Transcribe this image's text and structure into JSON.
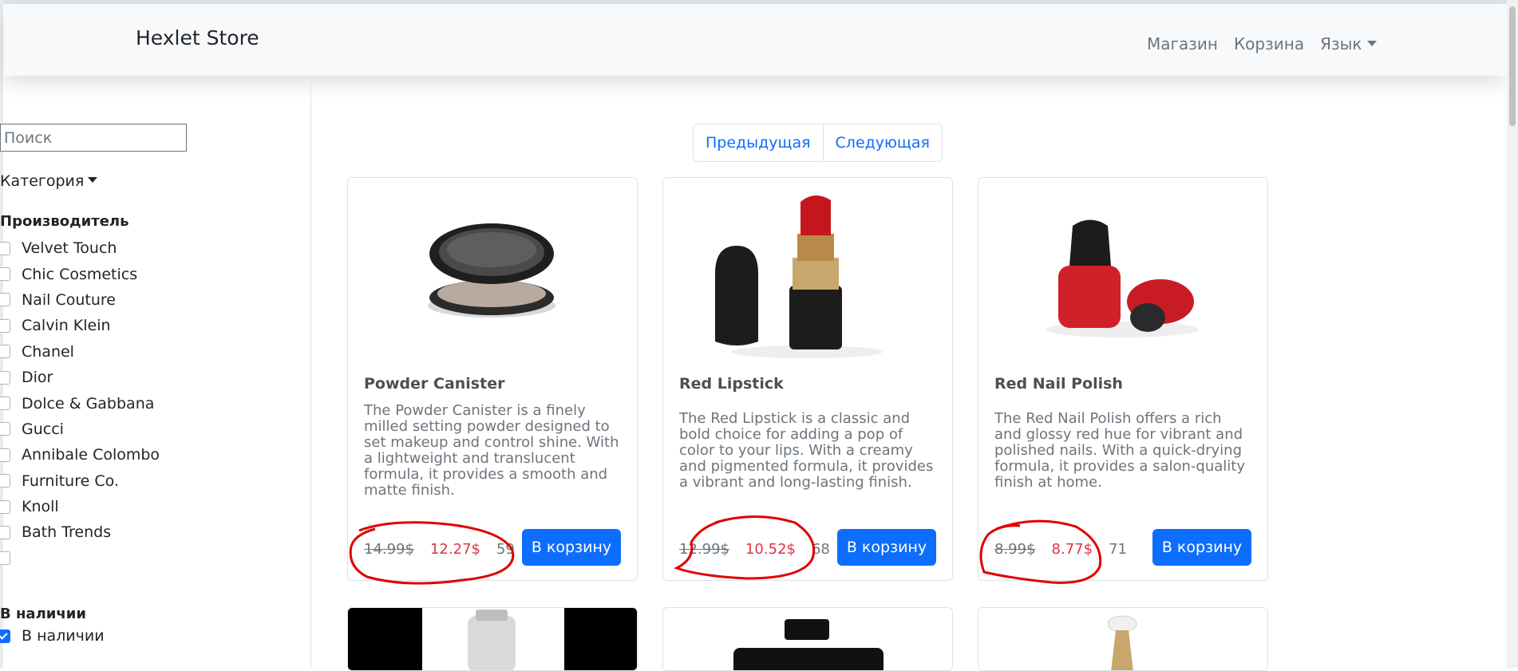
{
  "navbar": {
    "brand": "Hexlet Store",
    "links": [
      "Магазин",
      "Корзина",
      "Язык"
    ]
  },
  "sidebar": {
    "search_placeholder": "Поиск",
    "category_label": "Категория",
    "manufacturer_title": "Производитель",
    "manufacturers": [
      "Velvet Touch",
      "Chic Cosmetics",
      "Nail Couture",
      "Calvin Klein",
      "Chanel",
      "Dior",
      "Dolce & Gabbana",
      "Gucci",
      "Annibale Colombo",
      "Furniture Co.",
      "Knoll",
      "Bath Trends",
      ""
    ],
    "in_stock_title": "В наличии",
    "in_stock_label": "В наличии",
    "in_stock_checked": true
  },
  "pagination": {
    "prev": "Предыдущая",
    "next": "Следующая"
  },
  "products": [
    {
      "title": "Powder Canister",
      "description": "The Powder Canister is a finely milled setting powder designed to set makeup and control shine. With a lightweight and translucent formula, it provides a smooth and matte finish.",
      "old_price": "14.99$",
      "new_price": "12.27$",
      "stock": "59",
      "button": "В корзину",
      "image_icon": "powder-compact"
    },
    {
      "title": "Red Lipstick",
      "description": "The Red Lipstick is a classic and bold choice for adding a pop of color to your lips. With a creamy and pigmented formula, it provides a vibrant and long-lasting finish.",
      "old_price": "12.99$",
      "new_price": "10.52$",
      "stock": "68",
      "button": "В корзину",
      "image_icon": "lipstick"
    },
    {
      "title": "Red Nail Polish",
      "description": "The Red Nail Polish offers a rich and glossy red hue for vibrant and polished nails. With a quick-drying formula, it provides a salon-quality finish at home.",
      "old_price": "8.99$",
      "new_price": "8.77$",
      "stock": "71",
      "button": "В корзину",
      "image_icon": "nail-polish"
    }
  ],
  "colors": {
    "accent": "#0d6efd",
    "sale": "#dc3545",
    "annotation": "#e00000"
  }
}
